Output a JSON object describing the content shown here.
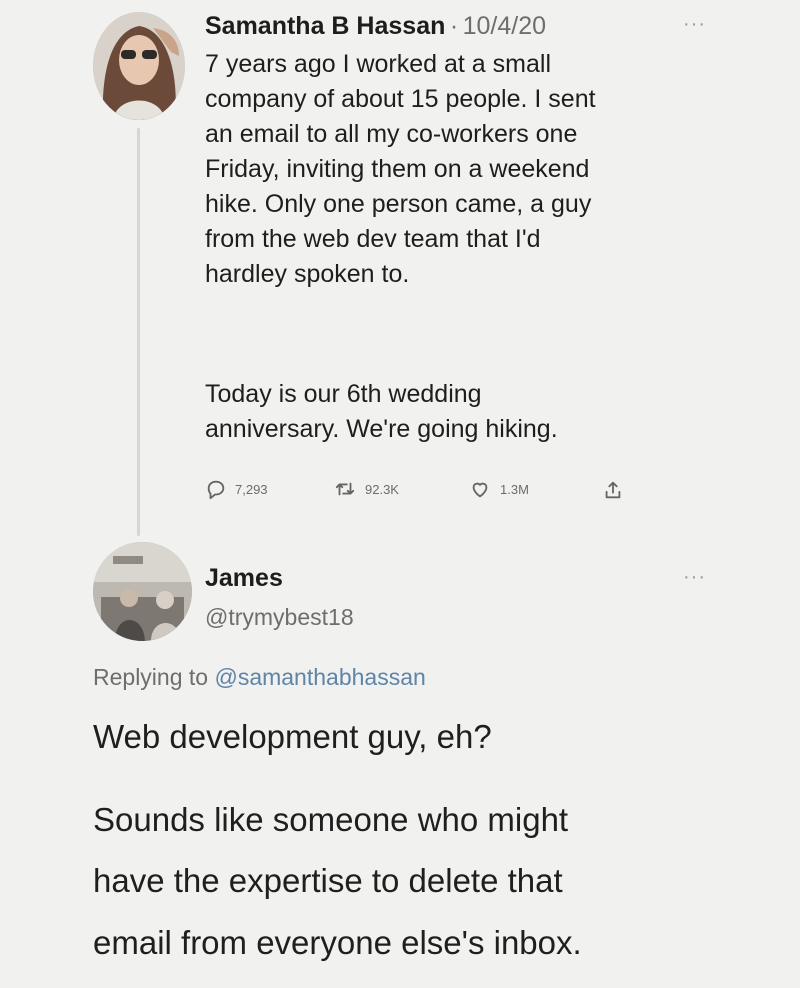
{
  "tweet1": {
    "author": "Samantha B Hassan",
    "separator": "·",
    "date": "10/4/20",
    "more": "···",
    "paragraphs": [
      "7 years ago I worked at a small\ncompany of about 15 people. I sent\nan email to all my co-workers one\nFriday, inviting them on a weekend\nhike. Only one person came, a guy\nfrom the web dev team that I'd\nhardley spoken to.",
      "Today is our 6th wedding\nanniversary. We're going hiking."
    ],
    "actions": {
      "replies": "7,293",
      "retweets": "92.3K",
      "likes": "1.3M"
    }
  },
  "tweet2": {
    "author": "James",
    "handle": "@trymybest18",
    "more": "···",
    "replying_prefix": "Replying to",
    "replying_to": "@samanthabhassan",
    "paragraphs": [
      "Web development guy, eh?",
      "Sounds like someone who might",
      "have the expertise to delete that",
      "email from everyone else's inbox."
    ]
  },
  "colors": {
    "background": "#f1f1ef",
    "text": "#1f1f1f",
    "secondary_text": "#6e6e6e",
    "mention": "#5e84a8",
    "thread_line": "#d6d6d3"
  },
  "icons": [
    "reply-icon",
    "retweet-icon",
    "like-icon",
    "share-icon",
    "more-icon"
  ]
}
